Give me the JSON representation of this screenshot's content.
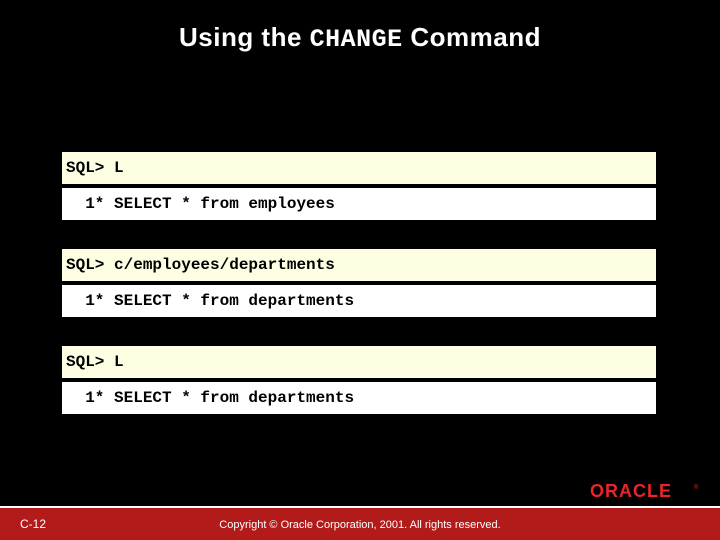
{
  "title_pre": "Using the ",
  "title_cmd": "CHANGE",
  "title_post": " Command",
  "code": {
    "cmd1": "SQL> L",
    "out1": "  1* SELECT * from employees",
    "cmd2": "SQL> c/employees/departments",
    "out2": "  1* SELECT * from departments",
    "cmd3": "SQL> L",
    "out3": "  1* SELECT * from departments"
  },
  "footer": {
    "slide_num": "C-12",
    "copyright": "Copyright © Oracle Corporation, 2001. All rights reserved.",
    "logo_text": "ORACLE"
  }
}
